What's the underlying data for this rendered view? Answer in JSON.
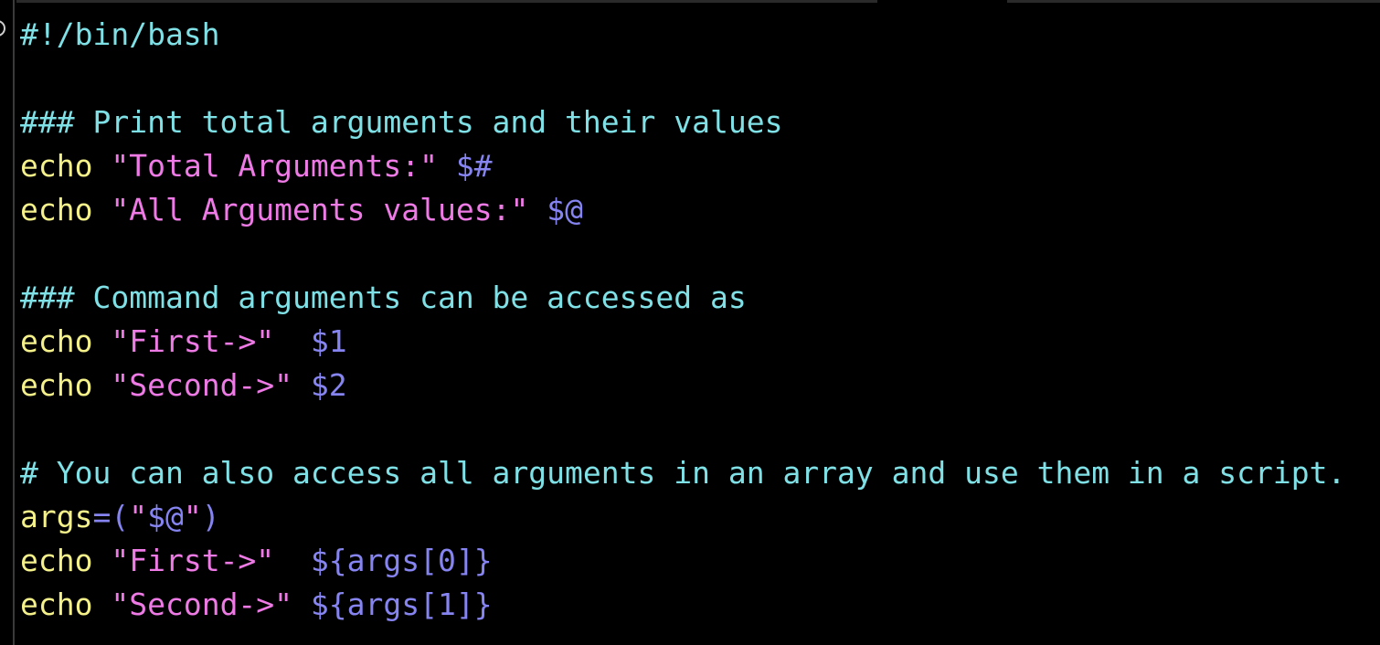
{
  "editor": {
    "lines": [
      {
        "tokens": [
          {
            "type": "shebang",
            "text": "#!/bin/bash"
          }
        ]
      },
      {
        "tokens": []
      },
      {
        "tokens": [
          {
            "type": "comment",
            "text": "### Print total arguments and their values"
          }
        ]
      },
      {
        "tokens": [
          {
            "type": "builtin",
            "text": "echo"
          },
          {
            "type": "plain",
            "text": " "
          },
          {
            "type": "string",
            "text": "\"Total Arguments:\""
          },
          {
            "type": "plain",
            "text": " "
          },
          {
            "type": "var",
            "text": "$#"
          }
        ]
      },
      {
        "tokens": [
          {
            "type": "builtin",
            "text": "echo"
          },
          {
            "type": "plain",
            "text": " "
          },
          {
            "type": "string",
            "text": "\"All Arguments values:\""
          },
          {
            "type": "plain",
            "text": " "
          },
          {
            "type": "var",
            "text": "$@"
          }
        ]
      },
      {
        "tokens": []
      },
      {
        "tokens": [
          {
            "type": "comment",
            "text": "### Command arguments can be accessed as"
          }
        ]
      },
      {
        "tokens": [
          {
            "type": "builtin",
            "text": "echo"
          },
          {
            "type": "plain",
            "text": " "
          },
          {
            "type": "string",
            "text": "\"First->\""
          },
          {
            "type": "plain",
            "text": "  "
          },
          {
            "type": "var",
            "text": "$1"
          }
        ]
      },
      {
        "tokens": [
          {
            "type": "builtin",
            "text": "echo"
          },
          {
            "type": "plain",
            "text": " "
          },
          {
            "type": "string",
            "text": "\"Second->\""
          },
          {
            "type": "plain",
            "text": " "
          },
          {
            "type": "var",
            "text": "$2"
          }
        ]
      },
      {
        "tokens": []
      },
      {
        "tokens": [
          {
            "type": "comment",
            "text": "# You can also access all arguments in an array and use them in a script."
          }
        ]
      },
      {
        "tokens": [
          {
            "type": "ident",
            "text": "args"
          },
          {
            "type": "op",
            "text": "=("
          },
          {
            "type": "string",
            "text": "\""
          },
          {
            "type": "var",
            "text": "$@"
          },
          {
            "type": "string",
            "text": "\""
          },
          {
            "type": "op",
            "text": ")"
          }
        ]
      },
      {
        "tokens": [
          {
            "type": "builtin",
            "text": "echo"
          },
          {
            "type": "plain",
            "text": " "
          },
          {
            "type": "string",
            "text": "\"First->\""
          },
          {
            "type": "plain",
            "text": "  "
          },
          {
            "type": "var",
            "text": "${args[0]}"
          }
        ]
      },
      {
        "tokens": [
          {
            "type": "builtin",
            "text": "echo"
          },
          {
            "type": "plain",
            "text": " "
          },
          {
            "type": "string",
            "text": "\"Second->\""
          },
          {
            "type": "plain",
            "text": " "
          },
          {
            "type": "var",
            "text": "${args[1]}"
          }
        ]
      }
    ]
  },
  "colors": {
    "background": "#000000",
    "comment": "#7fe0e6",
    "builtin": "#f4f08a",
    "string": "#ee7ae6",
    "variable": "#8684f0"
  }
}
